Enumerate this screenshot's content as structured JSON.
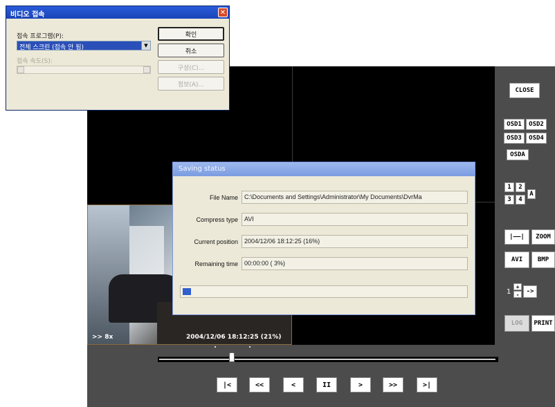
{
  "connect_dialog": {
    "title": "비디오 접속",
    "close_glyph": "✕",
    "program_label": "접속 프로그램(P):",
    "program_value": "전체 스크린 (접속 안 됨)",
    "speed_label": "접속 속도(S):",
    "buttons": {
      "ok": "확인",
      "cancel": "취소",
      "config": "구성(C)...",
      "info": "정보(A)..."
    }
  },
  "saving_dialog": {
    "title": "Saving status",
    "fields": [
      {
        "label": "File Name",
        "value": "C:\\Documents and Settings\\Administrator\\My Documents\\DvrMa"
      },
      {
        "label": "Compress type",
        "value": "AVI"
      },
      {
        "label": "Current position",
        "value": "2004/12/06 18:12:25 (16%)"
      },
      {
        "label": "Remaining time",
        "value": "00:00:00 ( 3%)"
      }
    ],
    "progress": 0.03
  },
  "camera": {
    "speed": ">> 8x",
    "timestamp": "2004/12/06 18:12:25 (21%)"
  },
  "controls": {
    "close": "CLOSE",
    "osd1": "OSD1",
    "osd2": "OSD2",
    "osd3": "OSD3",
    "osd4": "OSD4",
    "osda": "OSDA",
    "split1": "1",
    "split2": "2",
    "split3": "3",
    "split4": "4",
    "split_a": "A",
    "range": "|——|",
    "zoom": "ZOOM",
    "avi": "AVI",
    "bmp": "BMP",
    "step_value": "1",
    "step_up": "+",
    "step_down": "-",
    "step_go": "->",
    "log": "LOG",
    "print": "PRINT"
  },
  "timeline": {
    "position": 0.21
  },
  "transport": {
    "first": "|<",
    "rewind": "<<",
    "back": "<",
    "pause": "II",
    "play": ">",
    "forward": ">>",
    "last": ">|"
  }
}
